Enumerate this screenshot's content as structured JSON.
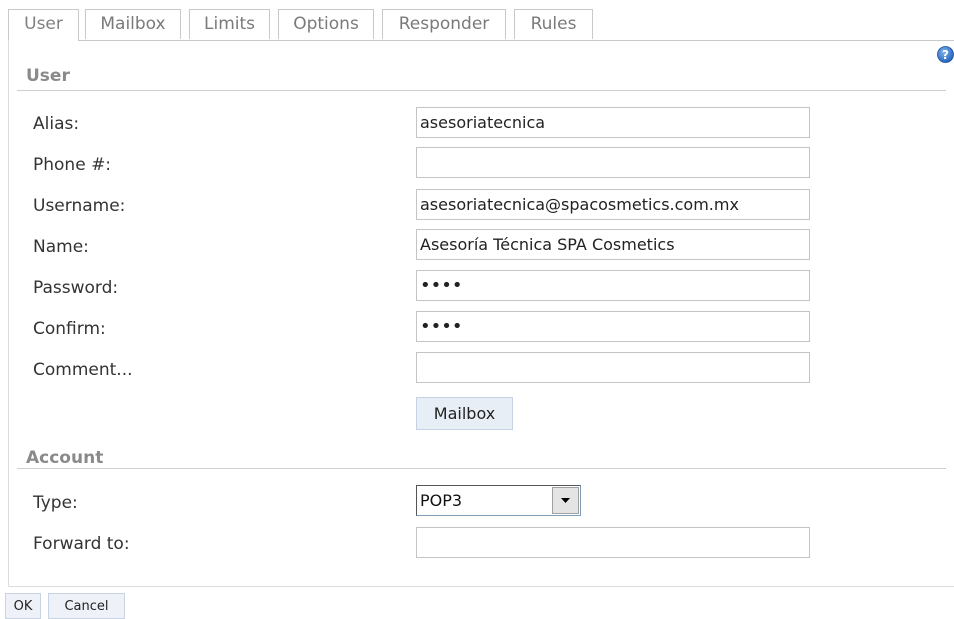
{
  "tabs": [
    {
      "label": "User",
      "active": true
    },
    {
      "label": "Mailbox",
      "active": false
    },
    {
      "label": "Limits",
      "active": false
    },
    {
      "label": "Options",
      "active": false
    },
    {
      "label": "Responder",
      "active": false
    },
    {
      "label": "Rules",
      "active": false
    }
  ],
  "help_icon": "help-icon",
  "user_section": {
    "title": "User",
    "fields": {
      "alias": {
        "label": "Alias:",
        "value": "asesoriatecnica"
      },
      "phone": {
        "label": "Phone #:",
        "value": ""
      },
      "username": {
        "label": "Username:",
        "value": "asesoriatecnica@spacosmetics.com.mx"
      },
      "name": {
        "label": "Name:",
        "value": "Asesoría Técnica SPA Cosmetics"
      },
      "password": {
        "label": "Password:",
        "value": "••••"
      },
      "confirm": {
        "label": "Confirm:",
        "value": "••••"
      },
      "comment": {
        "label": "Comment...",
        "value": ""
      }
    },
    "mailbox_button": "Mailbox"
  },
  "account_section": {
    "title": "Account",
    "type": {
      "label": "Type:",
      "value": "POP3"
    },
    "forward": {
      "label": "Forward to:",
      "value": ""
    }
  },
  "footer": {
    "ok_label": "OK",
    "cancel_label": "Cancel"
  },
  "colors": {
    "accent_icon": "#2a6fc9",
    "button_bg": "#e8eef6"
  }
}
